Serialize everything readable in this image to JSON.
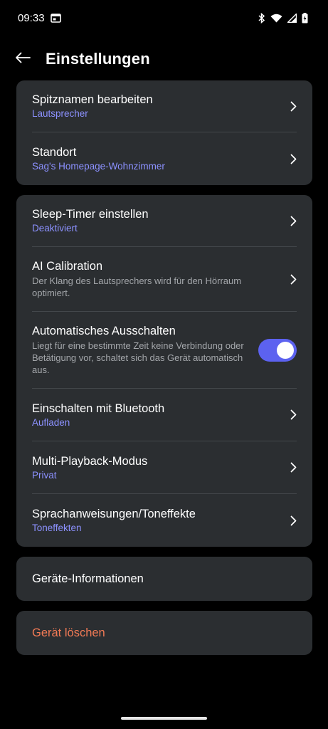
{
  "status_bar": {
    "time": "09:33",
    "icons": [
      "calendar-notification-icon",
      "bluetooth-icon",
      "wifi-icon",
      "cell-signal-icon",
      "battery-charging-icon"
    ]
  },
  "header": {
    "back_icon": "arrow-left-icon",
    "title": "Einstellungen"
  },
  "group1": {
    "nickname": {
      "title": "Spitznamen bearbeiten",
      "value": "Lautsprecher"
    },
    "location": {
      "title": "Standort",
      "value": "Sag's Homepage-Wohnzimmer"
    }
  },
  "group2": {
    "sleep_timer": {
      "title": "Sleep-Timer einstellen",
      "value": "Deaktiviert"
    },
    "ai_calibration": {
      "title": "AI Calibration",
      "description": "Der Klang des Lautsprechers wird für den Hörraum optimiert."
    },
    "auto_off": {
      "title": "Automatisches Ausschalten",
      "description": "Liegt für eine bestimmte Zeit keine Verbindung oder Betätigung vor, schaltet sich das Gerät automatisch aus.",
      "enabled": true
    },
    "bluetooth_on": {
      "title": "Einschalten mit Bluetooth",
      "value": "Aufladen"
    },
    "multi_playback": {
      "title": "Multi-Playback-Modus",
      "value": "Privat"
    },
    "voice_prompts": {
      "title": "Sprachanweisungen/Toneffekte",
      "value": "Toneffekten"
    }
  },
  "device_info": {
    "label": "Geräte-Informationen"
  },
  "delete_device": {
    "label": "Gerät löschen"
  },
  "colors": {
    "accent": "#8c91ff",
    "toggle_on": "#5c62f0",
    "danger": "#f27a55",
    "card": "#2b2e31"
  }
}
